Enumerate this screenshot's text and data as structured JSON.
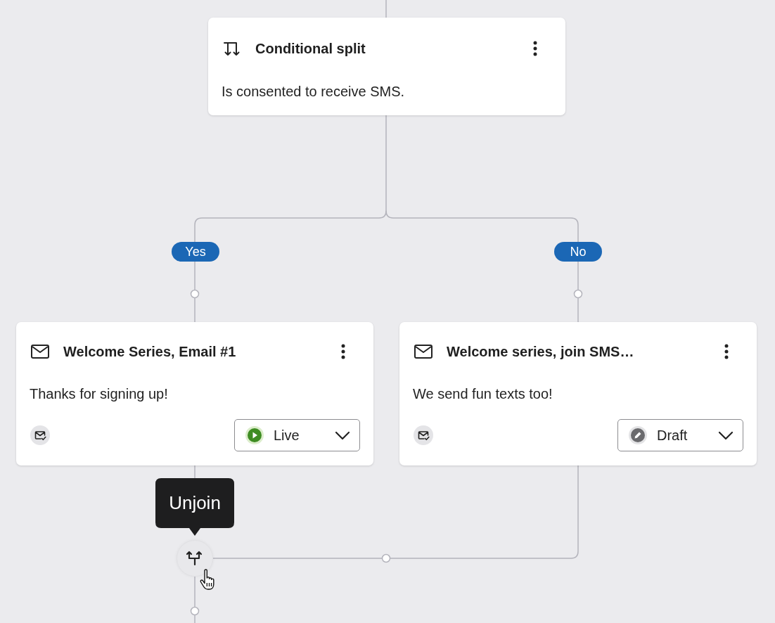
{
  "split_node": {
    "title": "Conditional split",
    "description": "Is consented to receive SMS."
  },
  "branches": [
    {
      "label": "Yes"
    },
    {
      "label": "No"
    }
  ],
  "message_nodes": [
    {
      "title": "Welcome Series, Email #1",
      "description": "Thanks for signing up!",
      "status": {
        "kind": "live",
        "label": "Live"
      }
    },
    {
      "title": "Welcome series, join SMS…",
      "description": "We send fun texts too!",
      "status": {
        "kind": "draft",
        "label": "Draft"
      }
    }
  ],
  "tooltip": {
    "text": "Unjoin"
  }
}
